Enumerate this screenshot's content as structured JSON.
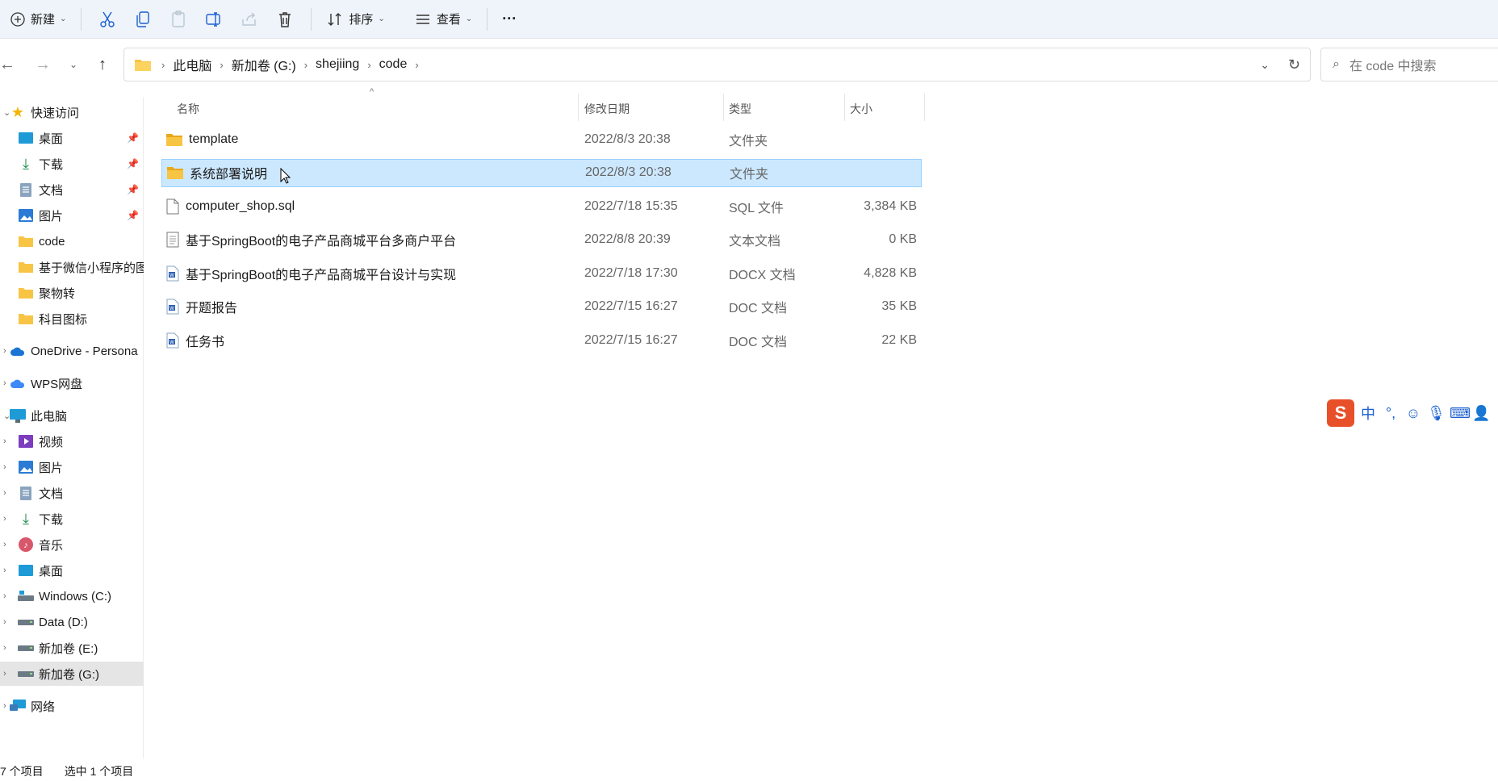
{
  "toolbar": {
    "new_label": "新建",
    "sort_label": "排序",
    "view_label": "查看",
    "more_label": "···"
  },
  "address": {
    "crumbs": [
      "此电脑",
      "新加卷 (G:)",
      "shejiing",
      "code"
    ]
  },
  "search": {
    "placeholder": "在 code 中搜索"
  },
  "sidebar": {
    "quick_access": "快速访问",
    "items": [
      {
        "label": "桌面"
      },
      {
        "label": "下载"
      },
      {
        "label": "文档"
      },
      {
        "label": "图片"
      },
      {
        "label": "code"
      },
      {
        "label": "基于微信小程序的图"
      },
      {
        "label": "聚物转"
      },
      {
        "label": "科目图标"
      }
    ],
    "onedrive": "OneDrive - Persona",
    "wps": "WPS网盘",
    "this_pc": "此电脑",
    "pc_items": [
      {
        "label": "视频"
      },
      {
        "label": "图片"
      },
      {
        "label": "文档"
      },
      {
        "label": "下载"
      },
      {
        "label": "音乐"
      },
      {
        "label": "桌面"
      },
      {
        "label": "Windows (C:)"
      },
      {
        "label": "Data (D:)"
      },
      {
        "label": "新加卷 (E:)"
      },
      {
        "label": "新加卷 (G:)"
      }
    ],
    "network": "网络"
  },
  "columns": {
    "name": "名称",
    "date": "修改日期",
    "type": "类型",
    "size": "大小"
  },
  "files": [
    {
      "name": "template",
      "date": "2022/8/3 20:38",
      "type": "文件夹",
      "size": "",
      "icon": "folder-icon"
    },
    {
      "name": "系统部署说明",
      "date": "2022/8/3 20:38",
      "type": "文件夹",
      "size": "",
      "icon": "folder-icon",
      "selected": true
    },
    {
      "name": "computer_shop.sql",
      "date": "2022/7/18 15:35",
      "type": "SQL 文件",
      "size": "3,384 KB",
      "icon": "file-icon"
    },
    {
      "name": "基于SpringBoot的电子产品商城平台多商户平台",
      "date": "2022/8/8 20:39",
      "type": "文本文档",
      "size": "0 KB",
      "icon": "text-file-icon"
    },
    {
      "name": "基于SpringBoot的电子产品商城平台设计与实现",
      "date": "2022/7/18 17:30",
      "type": "DOCX 文档",
      "size": "4,828 KB",
      "icon": "word-doc-icon"
    },
    {
      "name": "开题报告",
      "date": "2022/7/15 16:27",
      "type": "DOC 文档",
      "size": "35 KB",
      "icon": "word-doc-icon"
    },
    {
      "name": "任务书",
      "date": "2022/7/15 16:27",
      "type": "DOC 文档",
      "size": "22 KB",
      "icon": "word-doc-icon"
    }
  ],
  "status": {
    "count": "7 个项目",
    "selected": "选中 1 个项目"
  },
  "ime": {
    "mode": "中",
    "punct": "°,"
  },
  "colors": {
    "accent": "#cce8ff",
    "accent_border": "#99d1ff",
    "folder": "#f8c444",
    "toolbar_bg": "#eef4f9"
  }
}
